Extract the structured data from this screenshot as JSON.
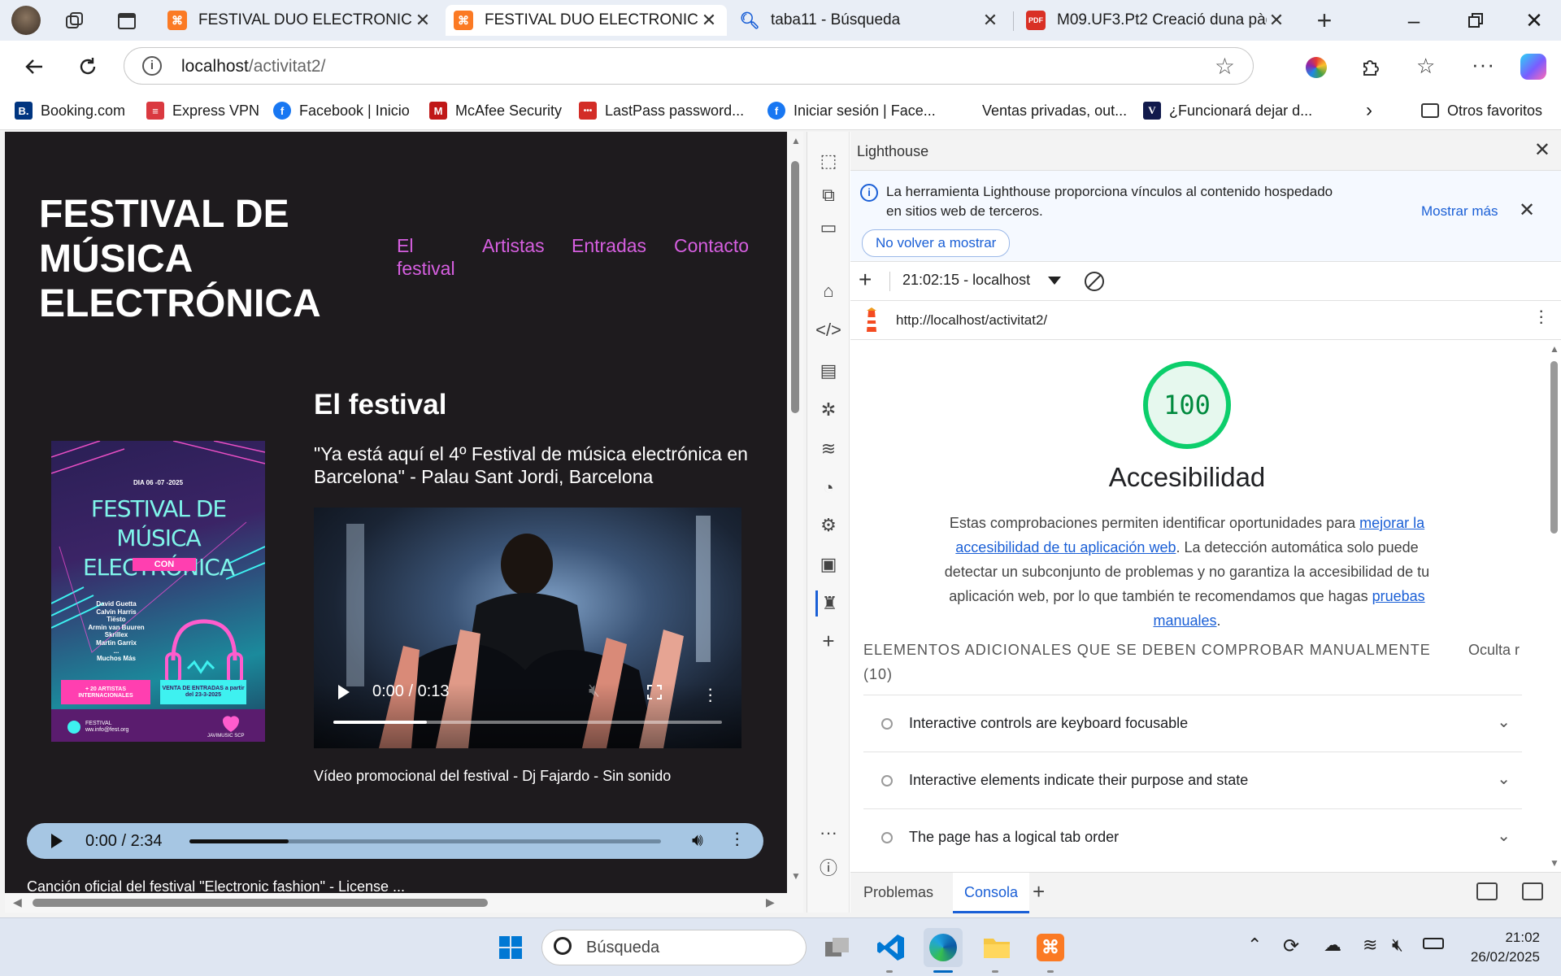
{
  "browser": {
    "tabs": [
      {
        "title": "FESTIVAL DUO ELECTRONIC",
        "icon": "xampp-icon",
        "active": false
      },
      {
        "title": "FESTIVAL DUO ELECTRONIC",
        "icon": "xampp-icon",
        "active": true
      },
      {
        "title": "taba11 - Búsqueda",
        "icon": "search-icon",
        "active": false
      },
      {
        "title": "M09.UF3.Pt2 Creació duna pàgina",
        "icon": "pdf-icon",
        "active": false
      }
    ],
    "address": {
      "host": "localhost",
      "path": "/activitat2/"
    },
    "bookmarks": [
      {
        "label": "Booking.com",
        "icon": "booking-icon",
        "color": "#003580",
        "glyph": "B."
      },
      {
        "label": "Express VPN",
        "icon": "expressvpn-icon",
        "color": "#da3940",
        "glyph": "≡"
      },
      {
        "label": "Facebook | Inicio",
        "icon": "facebook-icon",
        "color": "#1877f2",
        "glyph": "f"
      },
      {
        "label": "McAfee Security",
        "icon": "mcafee-icon",
        "color": "#c01818",
        "glyph": "M"
      },
      {
        "label": "LastPass password...",
        "icon": "lastpass-icon",
        "color": "#d32d27",
        "glyph": "•••"
      },
      {
        "label": "Iniciar sesión | Face...",
        "icon": "facebook-icon",
        "color": "#1877f2",
        "glyph": "f"
      },
      {
        "label": "Ventas privadas, out...",
        "icon": "",
        "color": "",
        "glyph": ""
      },
      {
        "label": "¿Funcionará dejar d...",
        "icon": "vanguardia-icon",
        "color": "#111a4c",
        "glyph": "V"
      }
    ],
    "other_favorites": "Otros favoritos"
  },
  "page": {
    "site_title": "FESTIVAL DE MÚSICA ELECTRÓNICA",
    "nav": [
      "El festival",
      "Artistas",
      "Entradas",
      "Contacto"
    ],
    "section_title": "El festival",
    "quote": "\"Ya está aquí el 4º Festival de música electrónica en Barcelona\" - Palau Sant Jordi, Barcelona",
    "poster": {
      "date": "DIA 06 -07 -2025",
      "title": "FESTIVAL DE MÚSICA ELECTRÓNICA",
      "subtitle": "CON",
      "artists": [
        "David Guetta",
        "Calvin Harris",
        "Tiësto",
        "Armin van Buuren",
        "Skrillex",
        "Martin Garrix",
        "...",
        "Muchos Más"
      ],
      "badge_left": "+ 20 ARTISTAS INTERNACIONALES",
      "badge_right": "VENTA DE ENTRADAS a partir del 23-3-2025",
      "footer_left": "FESTIVAL ww.info@fest.org",
      "footer_right": "JAVIMUSIC SCP"
    },
    "video": {
      "time": "0:00 / 0:13",
      "progress": 0.24
    },
    "video_caption": "Vídeo promocional del festival - Dj Fajardo - Sin sonido",
    "audio": {
      "time": "0:00 / 2:34",
      "progress": 0.21
    },
    "audio_caption": "Canción oficial del festival \"Electronic fashion\" - License ..."
  },
  "devtools": {
    "panel_title": "Lighthouse",
    "info_text": "La herramienta Lighthouse proporciona vínculos al contenido hospedado en sitios web de terceros.",
    "info_dismiss": "No volver a mostrar",
    "info_more": "Mostrar más",
    "report_select": "21:02:15 - localhost",
    "report_url": "http://localhost/activitat2/",
    "score": "100",
    "category": "Accesibilidad",
    "desc_1": "Estas comprobaciones permiten identificar oportunidades para ",
    "desc_link1": "mejorar la accesibilidad de tu aplicación web",
    "desc_2": ". La detección automática solo puede detectar un subconjunto de problemas y no garantiza la accesibilidad de tu aplicación web, por lo que también te recomendamos que hagas ",
    "desc_link2": "pruebas manuales",
    "desc_3": ".",
    "manual_heading": "ELEMENTOS ADICIONALES QUE SE DEBEN COMPROBAR MANUALMENTE",
    "manual_count": "(10)",
    "hide_label": "Oculta r",
    "audits": [
      "Interactive controls are keyboard focusable",
      "Interactive elements indicate their purpose and state",
      "The page has a logical tab order"
    ],
    "drawer_tabs": [
      "Problemas",
      "Consola"
    ]
  },
  "taskbar": {
    "search_placeholder": "Búsqueda",
    "time": "21:02",
    "date": "26/02/2025"
  },
  "colors": {
    "accent_link": "#d65fe0",
    "page_bg": "#1e1b1e",
    "score_green": "#0cce6b"
  }
}
